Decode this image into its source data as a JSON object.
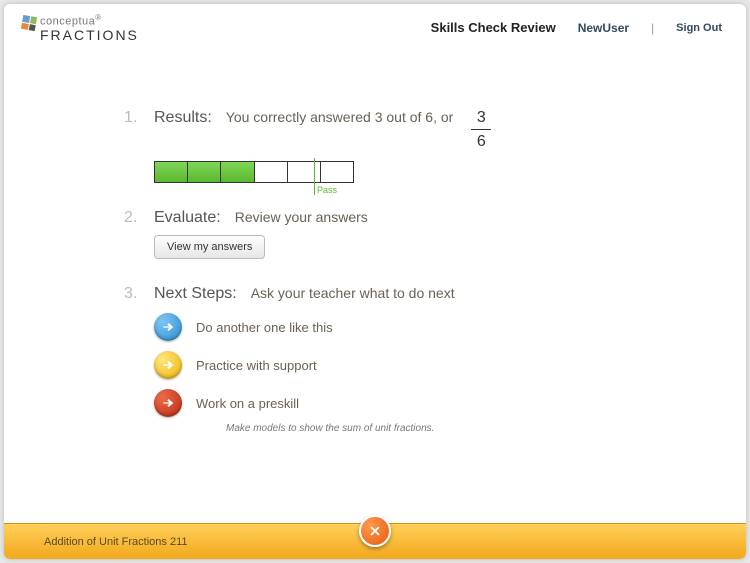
{
  "brand": {
    "top": "conceptua",
    "bottom": "FRACTIONS"
  },
  "header": {
    "title": "Skills Check Review",
    "user": "NewUser",
    "divider": "|",
    "signout": "Sign Out"
  },
  "results": {
    "num": "1.",
    "label": "Results:",
    "text": "You correctly answered 3 out of 6, or",
    "numerator": "3",
    "denominator": "6",
    "correct": 3,
    "total": 6,
    "pass_threshold_pct": 80,
    "pass_label": "Pass"
  },
  "evaluate": {
    "num": "2.",
    "label": "Evaluate:",
    "text": "Review your answers",
    "button": "View my answers"
  },
  "next": {
    "num": "3.",
    "label": "Next Steps:",
    "text": "Ask your teacher what to do next",
    "items": [
      {
        "label": "Do another one like this"
      },
      {
        "label": "Practice with support"
      },
      {
        "label": "Work on a preskill"
      }
    ],
    "subnote": "Make models to show the sum of unit fractions."
  },
  "footer": {
    "title": "Addition of Unit Fractions 211"
  }
}
